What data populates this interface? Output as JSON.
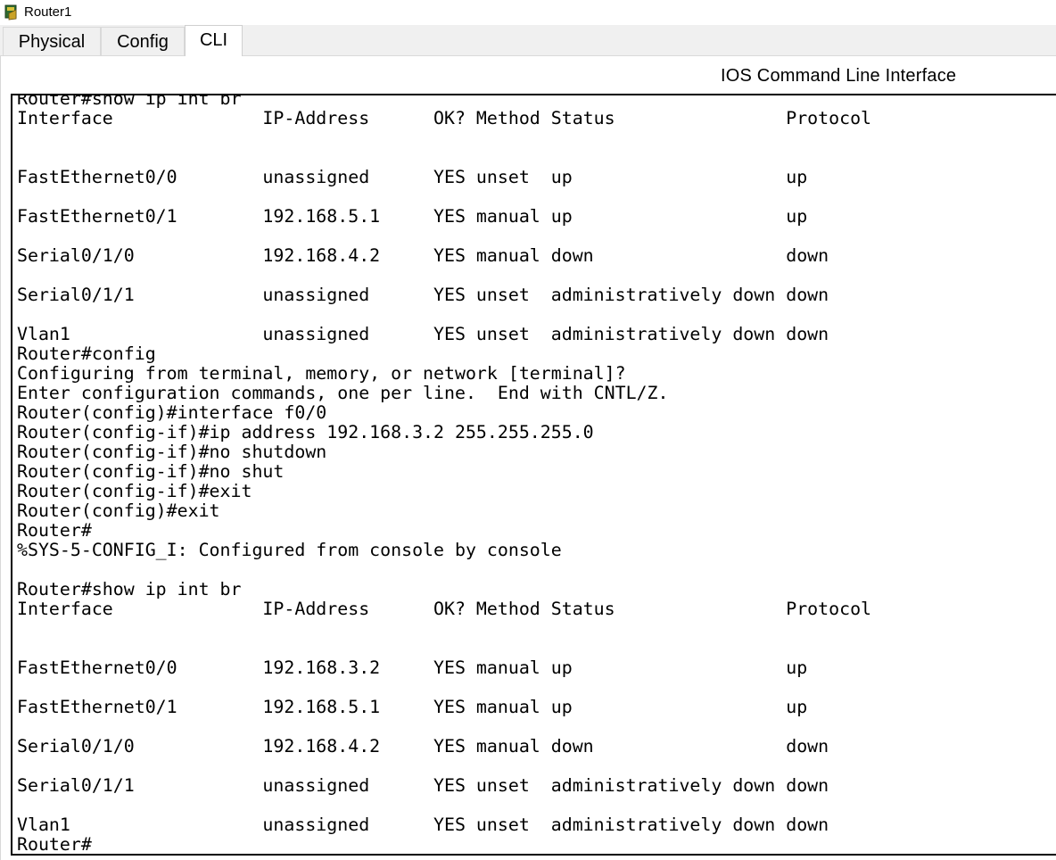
{
  "window": {
    "title": "Router1",
    "icon": "router-icon"
  },
  "tabs": [
    {
      "label": "Physical",
      "active": false
    },
    {
      "label": "Config",
      "active": false
    },
    {
      "label": "CLI",
      "active": true
    }
  ],
  "cli": {
    "heading": "IOS Command Line Interface",
    "lines": [
      "Router#show ip int br",
      "Interface              IP-Address      OK? Method Status                Protocol",
      "",
      "",
      "FastEthernet0/0        unassigned      YES unset  up                    up",
      "",
      "FastEthernet0/1        192.168.5.1     YES manual up                    up",
      "",
      "Serial0/1/0            192.168.4.2     YES manual down                  down",
      "",
      "Serial0/1/1            unassigned      YES unset  administratively down down",
      "",
      "Vlan1                  unassigned      YES unset  administratively down down",
      "Router#config",
      "Configuring from terminal, memory, or network [terminal]?",
      "Enter configuration commands, one per line.  End with CNTL/Z.",
      "Router(config)#interface f0/0",
      "Router(config-if)#ip address 192.168.3.2 255.255.255.0",
      "Router(config-if)#no shutdown",
      "Router(config-if)#no shut",
      "Router(config-if)#exit",
      "Router(config)#exit",
      "Router#",
      "%SYS-5-CONFIG_I: Configured from console by console",
      "",
      "Router#show ip int br",
      "Interface              IP-Address      OK? Method Status                Protocol",
      "",
      "",
      "FastEthernet0/0        192.168.3.2     YES manual up                    up",
      "",
      "FastEthernet0/1        192.168.5.1     YES manual up                    up",
      "",
      "Serial0/1/0            192.168.4.2     YES manual down                  down",
      "",
      "Serial0/1/1            unassigned      YES unset  administratively down down",
      "",
      "Vlan1                  unassigned      YES unset  administratively down down",
      "Router#"
    ]
  }
}
